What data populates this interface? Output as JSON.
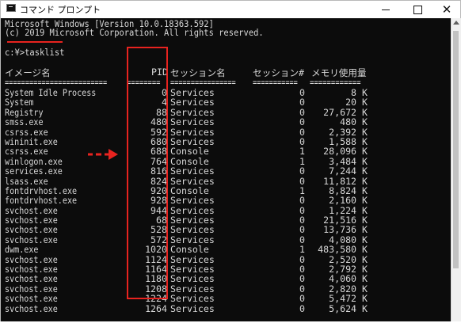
{
  "window": {
    "title": "コマンド プロンプト",
    "minimize_icon": "minimize-icon",
    "maximize_icon": "maximize-icon",
    "close_icon": "close-icon"
  },
  "console": {
    "banner_line1": "Microsoft Windows [Version 10.0.18363.592]",
    "banner_line2": "(c) 2019 Microsoft Corporation. All rights reserved.",
    "prompt": "c:¥>tasklist",
    "headers": {
      "image_name": "イメージ名",
      "pid": "PID",
      "session_name": "セッション名",
      "session_num": "セッション#",
      "mem_usage": "メモリ使用量"
    },
    "separator": {
      "image_name": "=========================",
      "pid": "========",
      "session_name": "================",
      "session_num": "===========",
      "mem_usage": "============"
    },
    "rows": [
      {
        "name": "System Idle Process",
        "pid": "0",
        "session": "Services",
        "num": "0",
        "mem": "8 K"
      },
      {
        "name": "System",
        "pid": "4",
        "session": "Services",
        "num": "0",
        "mem": "20 K"
      },
      {
        "name": "Registry",
        "pid": "88",
        "session": "Services",
        "num": "0",
        "mem": "27,672 K"
      },
      {
        "name": "smss.exe",
        "pid": "480",
        "session": "Services",
        "num": "0",
        "mem": "480 K"
      },
      {
        "name": "csrss.exe",
        "pid": "592",
        "session": "Services",
        "num": "0",
        "mem": "2,392 K"
      },
      {
        "name": "wininit.exe",
        "pid": "680",
        "session": "Services",
        "num": "0",
        "mem": "1,588 K"
      },
      {
        "name": "csrss.exe",
        "pid": "688",
        "session": "Console",
        "num": "1",
        "mem": "28,096 K"
      },
      {
        "name": "winlogon.exe",
        "pid": "764",
        "session": "Console",
        "num": "1",
        "mem": "3,484 K"
      },
      {
        "name": "services.exe",
        "pid": "816",
        "session": "Services",
        "num": "0",
        "mem": "7,244 K"
      },
      {
        "name": "lsass.exe",
        "pid": "824",
        "session": "Services",
        "num": "0",
        "mem": "11,812 K"
      },
      {
        "name": "fontdrvhost.exe",
        "pid": "920",
        "session": "Console",
        "num": "1",
        "mem": "8,824 K"
      },
      {
        "name": "fontdrvhost.exe",
        "pid": "928",
        "session": "Services",
        "num": "0",
        "mem": "2,160 K"
      },
      {
        "name": "svchost.exe",
        "pid": "944",
        "session": "Services",
        "num": "0",
        "mem": "1,224 K"
      },
      {
        "name": "svchost.exe",
        "pid": "68",
        "session": "Services",
        "num": "0",
        "mem": "21,516 K"
      },
      {
        "name": "svchost.exe",
        "pid": "528",
        "session": "Services",
        "num": "0",
        "mem": "13,736 K"
      },
      {
        "name": "svchost.exe",
        "pid": "572",
        "session": "Services",
        "num": "0",
        "mem": "4,080 K"
      },
      {
        "name": "dwm.exe",
        "pid": "1020",
        "session": "Console",
        "num": "1",
        "mem": "483,580 K"
      },
      {
        "name": "svchost.exe",
        "pid": "1124",
        "session": "Services",
        "num": "0",
        "mem": "2,520 K"
      },
      {
        "name": "svchost.exe",
        "pid": "1164",
        "session": "Services",
        "num": "0",
        "mem": "2,792 K"
      },
      {
        "name": "svchost.exe",
        "pid": "1180",
        "session": "Services",
        "num": "0",
        "mem": "4,060 K"
      },
      {
        "name": "svchost.exe",
        "pid": "1208",
        "session": "Services",
        "num": "0",
        "mem": "2,820 K"
      },
      {
        "name": "svchost.exe",
        "pid": "1224",
        "session": "Services",
        "num": "0",
        "mem": "5,472 K"
      },
      {
        "name": "svchost.exe",
        "pid": "1264",
        "session": "Services",
        "num": "0",
        "mem": "5,624 K"
      }
    ]
  },
  "annotations": {
    "highlight_color": "#e8231f",
    "arrow_icon": "dashed-arrow-right-icon"
  }
}
